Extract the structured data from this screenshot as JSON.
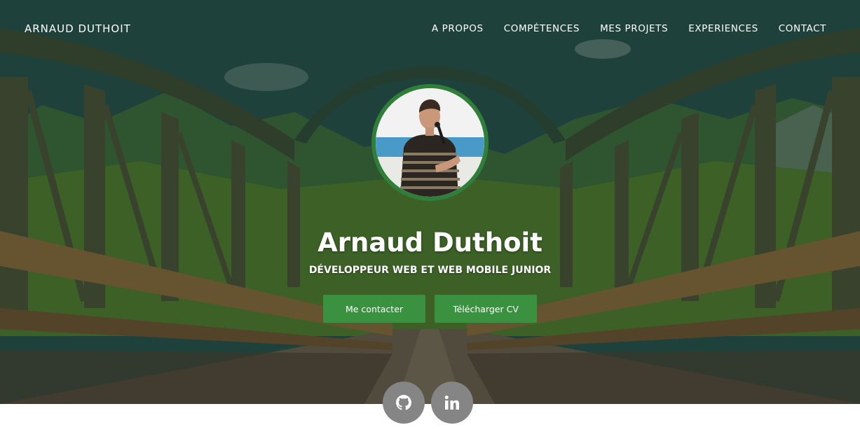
{
  "nav": {
    "brand": "ARNAUD DUTHOIT",
    "items": [
      {
        "label": "A PROPOS"
      },
      {
        "label": "COMPÉTENCES"
      },
      {
        "label": "MES PROJETS"
      },
      {
        "label": "EXPERIENCES"
      },
      {
        "label": "CONTACT"
      }
    ]
  },
  "hero": {
    "name": "Arnaud Duthoit",
    "subtitle": "DÉVELOPPEUR WEB ET WEB MOBILE JUNIOR",
    "buttons": {
      "contact_label": "Me contacter",
      "cv_label": "Télécharger CV"
    }
  },
  "social": {
    "github_icon": "github-icon",
    "linkedin_icon": "linkedin-icon",
    "linkedin_text": "in"
  },
  "colors": {
    "accent": "#3a9140",
    "avatar_border": "#2f7f3a",
    "social_bg": "#858585"
  }
}
